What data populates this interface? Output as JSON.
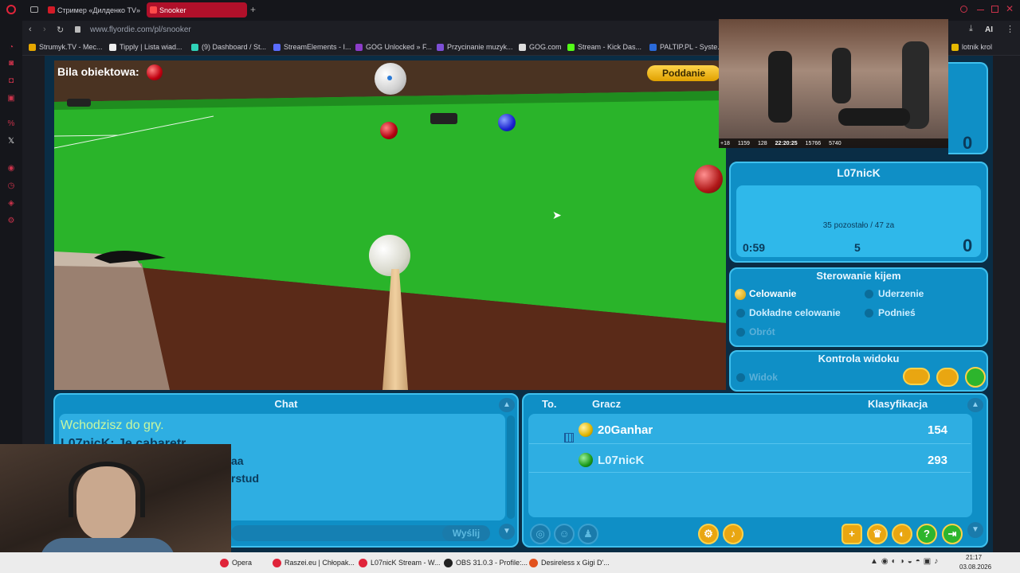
{
  "browser": {
    "tabs": [
      {
        "label": "Стример «Дилденко TV»",
        "color": "#d31b27"
      },
      {
        "label": "Snooker",
        "color": "#d31b27"
      }
    ],
    "new_tab": "+",
    "url": "www.flyordie.com/pl/snooker",
    "bookmarks": [
      "Strumyk.TV - Mec...",
      "Tipply | Lista wiad...",
      "(9) Dashboard / St...",
      "StreamElements - I...",
      "GOG Unlocked » F...",
      "Przycinanie muzyk...",
      "GOG.com",
      "Stream - Kick Das...",
      "PALTIP.PL - Syste...",
      "lotnik krol"
    ],
    "ai_label": "AI"
  },
  "game": {
    "object_ball_label": "Bila obiektowa:",
    "concede_button": "Poddanie",
    "opponent_score": "0",
    "player": {
      "name": "L07nicK",
      "status": "35 pozostało / 47 za",
      "timer": "0:59",
      "break": "5",
      "score": "0"
    },
    "cue_control": {
      "title": "Sterowanie kijem",
      "options": [
        "Celowanie",
        "Uderzenie",
        "Dokładne celowanie",
        "Podnieś",
        "Obrót"
      ],
      "selected": "Celowanie"
    },
    "view_control": {
      "title": "Kontrola widoku",
      "option": "Widok"
    },
    "chat": {
      "title": "Chat",
      "messages": [
        "Wchodzisz do gry.",
        "L07nicK: Je cabaretr",
        "aa",
        "rstud"
      ],
      "send_button": "Wyślij"
    },
    "players_table": {
      "headers": [
        "To.",
        "Gracz",
        "Klasyfikacja"
      ],
      "rows": [
        {
          "name": "20Ganhar",
          "rating": "154",
          "ball_color": "#e0b400"
        },
        {
          "name": "L07nicK",
          "rating": "293",
          "ball_color": "#1a9a1a"
        }
      ]
    }
  },
  "stream_overlay": {
    "viewers": "1159",
    "likes": "128",
    "time": "22:20:25",
    "count": "15766",
    "other": "5740",
    "age": "+18"
  },
  "taskbar": {
    "items": [
      "Opera",
      "Raszei.eu | Chłopak...",
      "L07nicK Stream - W...",
      "OBS 31.0.3 - Profile:...",
      "Desireless x Gigi D'..."
    ],
    "clock_time": "21:17",
    "clock_date": "03.08.2026"
  }
}
